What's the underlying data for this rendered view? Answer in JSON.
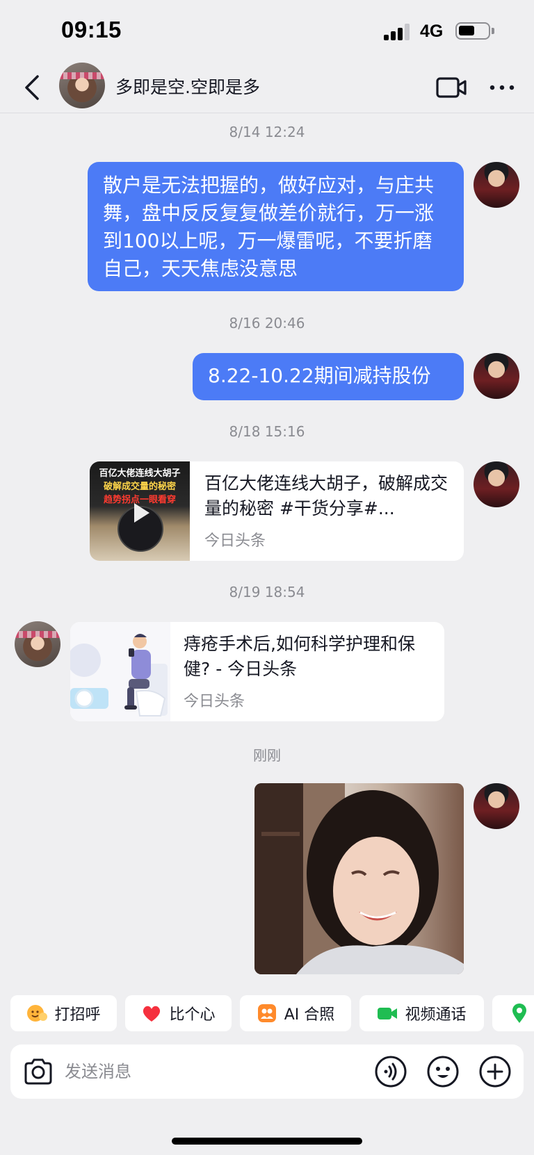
{
  "status_bar": {
    "time": "09:15",
    "network": "4G"
  },
  "header": {
    "contact_name": "多即是空.空即是多"
  },
  "messages": [
    {
      "timestamp": "8/14 12:24",
      "text": "散户是无法把握的，做好应对，与庄共舞，盘中反反复复做差价就行，万一涨到100以上呢，万一爆雷呢，不要折磨自己，天天焦虑没意思"
    },
    {
      "timestamp": "8/16 20:46",
      "text": "8.22-10.22期间减持股份"
    },
    {
      "timestamp": "8/18 15:16",
      "card_title": "百亿大佬连线大胡子，破解成交量的秘密 #干货分享#...",
      "card_source": "今日头条",
      "thumb_text": [
        "百亿大佬连线大胡子",
        "破解成交量的秘密",
        "趋势拐点一眼看穿"
      ]
    },
    {
      "timestamp": "8/19 18:54",
      "card_title": "痔疮手术后,如何科学护理和保健? - 今日头条",
      "card_source": "今日头条"
    },
    {
      "timestamp": "刚刚"
    }
  ],
  "quick_actions": [
    {
      "label": "打招呼",
      "icon": "wave-emoji-icon"
    },
    {
      "label": "比个心",
      "icon": "heart-icon"
    },
    {
      "label": "AI 合照",
      "icon": "ai-photo-icon"
    },
    {
      "label": "视频通话",
      "icon": "video-call-icon"
    },
    {
      "label": "",
      "icon": "location-icon"
    }
  ],
  "input": {
    "placeholder": "发送消息"
  },
  "colors": {
    "bubble": "#4c7bf6",
    "background": "#efeff1",
    "video_green": "#1fbd52",
    "heart_red": "#f5303e",
    "ai_orange": "#ff8a2b"
  }
}
